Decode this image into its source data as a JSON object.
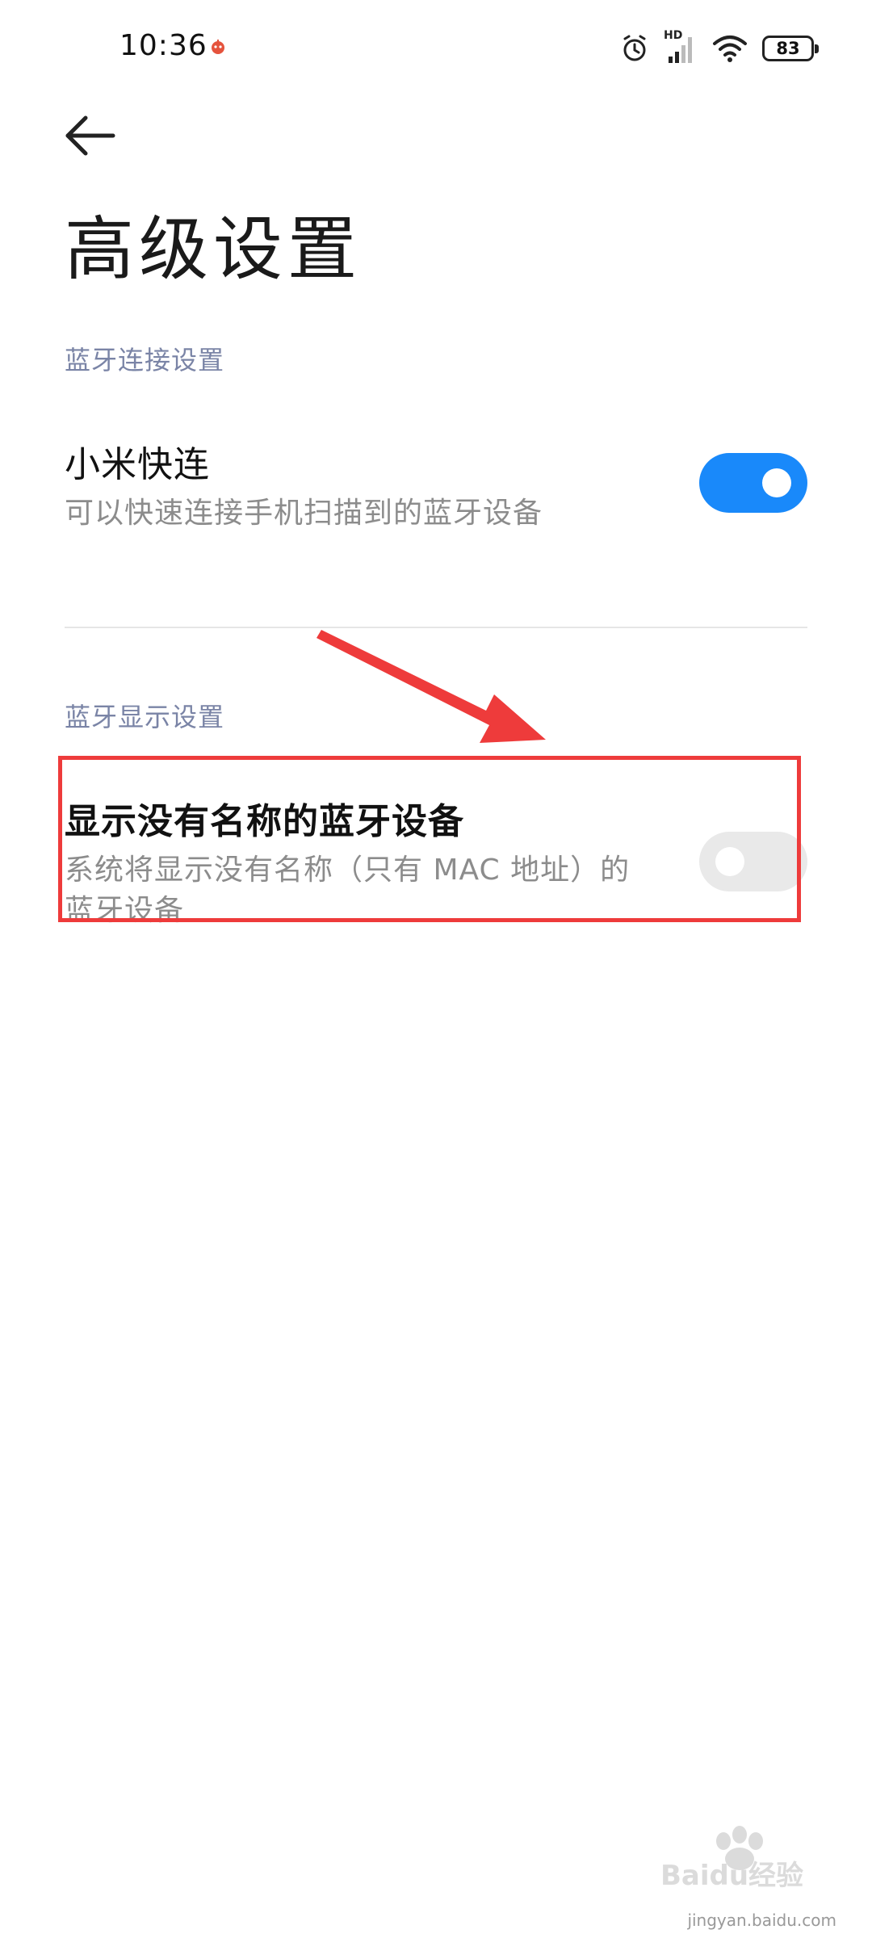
{
  "status_bar": {
    "time": "10:36",
    "battery_level": "83",
    "network_label": "HD"
  },
  "header": {
    "back_icon": "back-arrow-icon",
    "title": "高级设置"
  },
  "sections": [
    {
      "header": "蓝牙连接设置",
      "items": [
        {
          "title": "小米快连",
          "description": "可以快速连接手机扫描到的蓝牙设备",
          "enabled": true
        }
      ]
    },
    {
      "header": "蓝牙显示设置",
      "items": [
        {
          "title": "显示没有名称的蓝牙设备",
          "description_line1": "系统将显示没有名称（只有 MAC 地址）的",
          "description_line2": "蓝牙设备",
          "enabled": false
        }
      ]
    }
  ],
  "watermark": {
    "brand": "Baidu经验",
    "url": "jingyan.baidu.com"
  },
  "colors": {
    "accent": "#1989fa",
    "section_header": "#7a84a6",
    "annotation": "#ee3b3b"
  }
}
